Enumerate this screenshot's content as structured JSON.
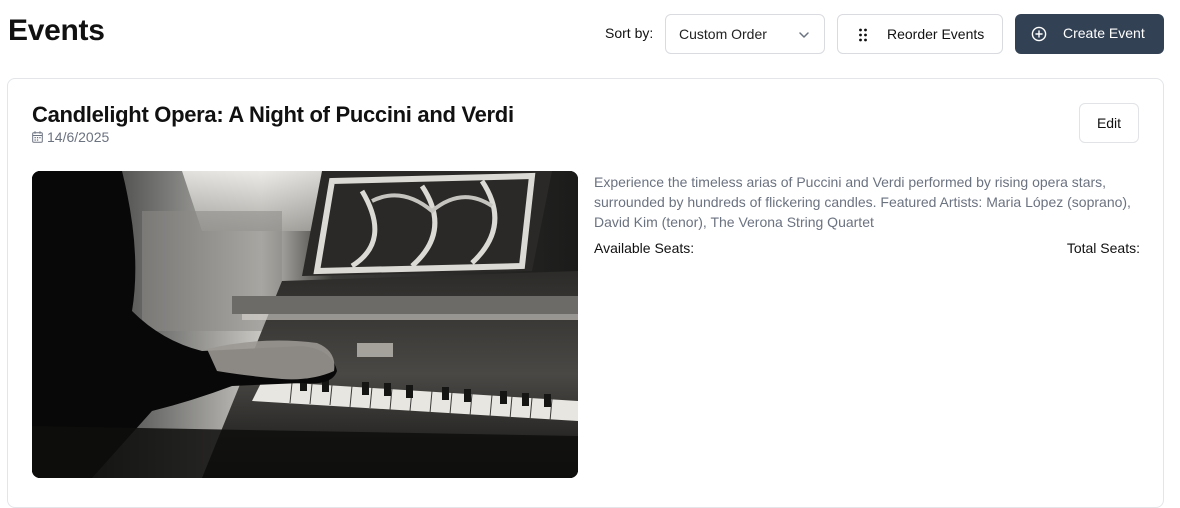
{
  "header": {
    "title": "Events",
    "sort_label": "Sort by:",
    "sort_value": "Custom Order",
    "reorder_label": "Reorder Events",
    "create_label": "Create Event"
  },
  "event": {
    "title": "Candlelight Opera: A Night of Puccini and Verdi",
    "date": "14/6/2025",
    "edit_label": "Edit",
    "description": "Experience the timeless arias of Puccini and Verdi performed by rising opera stars, surrounded by hundreds of flickering candles. Featured Artists: Maria López (soprano), David Kim (tenor), The Verona String Quartet",
    "available_seats_label": "Available Seats:",
    "total_seats_label": "Total Seats:",
    "image_subject": "black-and-white photo of hands playing an upright piano"
  },
  "colors": {
    "primary_button": "#334155",
    "muted_text": "#6b7280",
    "border": "#d9dbe0"
  }
}
